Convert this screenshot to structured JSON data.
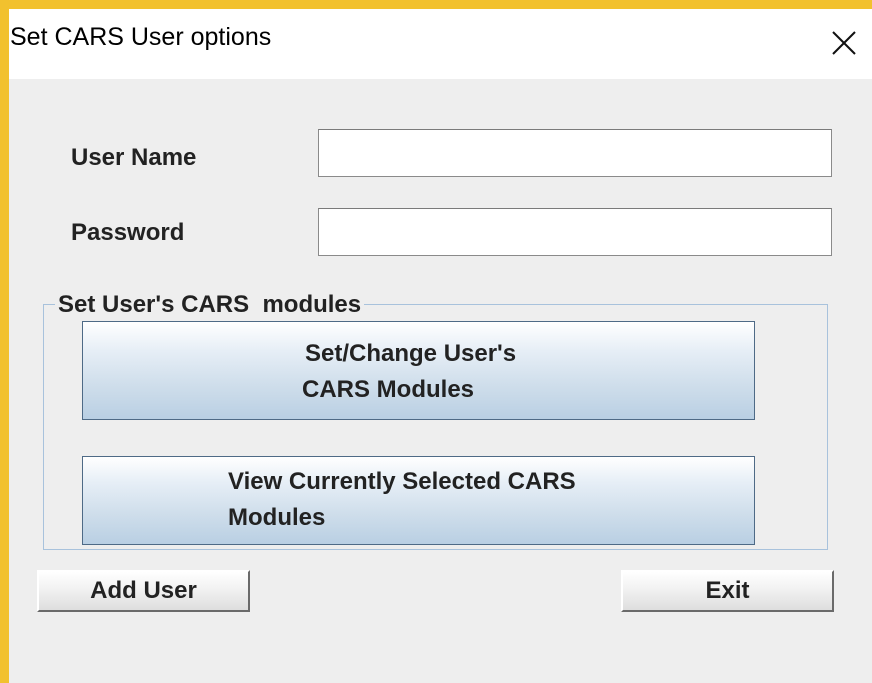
{
  "window": {
    "title": "Set CARS User options",
    "close_glyph": "✕"
  },
  "form": {
    "username_label": "User Name",
    "username_value": "",
    "password_label": "Password",
    "password_value": ""
  },
  "modules_group": {
    "legend": "Set User's CARS  modules",
    "set_change_button": {
      "line1": "Set/Change User's",
      "line2": "CARS Modules"
    },
    "view_button": {
      "line1": "View Currently Selected CARS",
      "line2": "Modules"
    }
  },
  "actions": {
    "add_user_label": "Add User",
    "exit_label": "Exit"
  },
  "colors": {
    "accent": "#f2c12e",
    "group_border": "#a8c2dc",
    "button_border": "#4e6a86"
  },
  "icons": {
    "close": "close-icon"
  }
}
